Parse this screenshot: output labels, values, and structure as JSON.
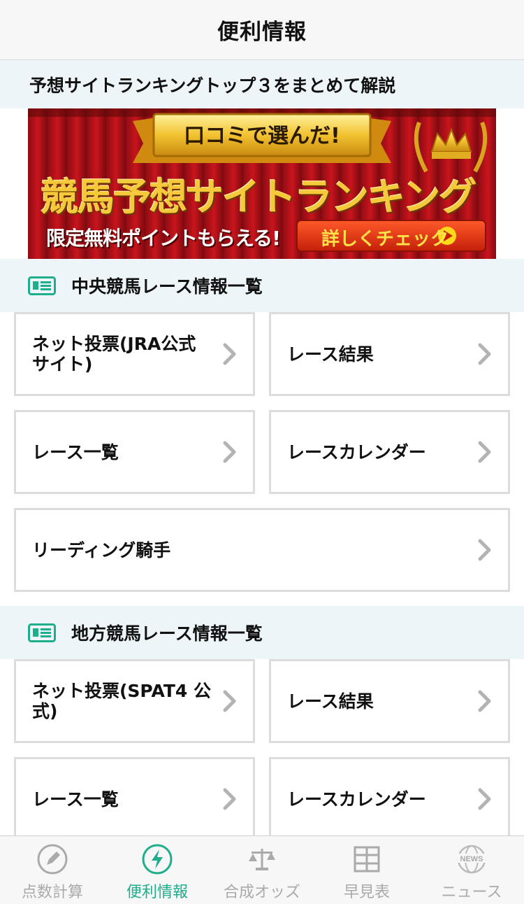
{
  "header": {
    "title": "便利情報"
  },
  "promo": {
    "title": "予想サイトランキングトップ３をまとめて解説",
    "banner": {
      "ribbon": "口コミで選んだ!",
      "headline": "競馬予想サイトランキング",
      "subline": "限定無料ポイントもらえる!",
      "button": "詳しくチェック"
    }
  },
  "central": {
    "title": "中央競馬レース情報一覧",
    "items": [
      {
        "line1": "ネット投票(JRA公式",
        "line2": "サイト)"
      },
      {
        "line1": "レース結果",
        "line2": ""
      },
      {
        "line1": "レース一覧",
        "line2": ""
      },
      {
        "line1": "レースカレンダー",
        "line2": ""
      },
      {
        "line1": "リーディング騎手",
        "line2": ""
      }
    ]
  },
  "local": {
    "title": "地方競馬レース情報一覧",
    "items": [
      {
        "line1": "ネット投票(SPAT4 公",
        "line2": "式)"
      },
      {
        "line1": "レース結果",
        "line2": ""
      },
      {
        "line1": "レース一覧",
        "line2": ""
      },
      {
        "line1": "レースカレンダー",
        "line2": ""
      }
    ]
  },
  "tabs": [
    {
      "label": "点数計算",
      "icon": "pencil-icon"
    },
    {
      "label": "便利情報",
      "icon": "lightning-icon"
    },
    {
      "label": "合成オッズ",
      "icon": "scales-icon"
    },
    {
      "label": "早見表",
      "icon": "grid-icon"
    },
    {
      "label": "ニュース",
      "icon": "news-globe-icon"
    }
  ],
  "colors": {
    "accent": "#1fae8c",
    "inactive": "#aaaaaa",
    "section_bg": "#eef5f9",
    "card_border": "#dcdcdc"
  }
}
